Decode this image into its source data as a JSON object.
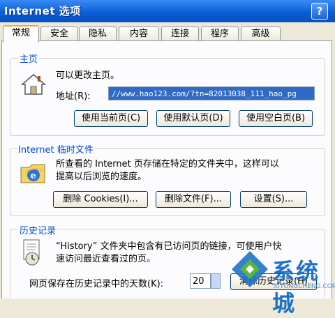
{
  "window": {
    "title": "Internet 选项",
    "help_label": "?"
  },
  "tabs": [
    "常规",
    "安全",
    "隐私",
    "内容",
    "连接",
    "程序",
    "高级"
  ],
  "home_group": {
    "title": "主页",
    "description": "可以更改主页。",
    "address_label": "地址(R):",
    "address_value": "//www.hao123.com/?tn=82013038_111_hao_pg",
    "btn_current": "使用当前页(C)",
    "btn_default": "使用默认页(D)",
    "btn_blank": "使用空白页(B)"
  },
  "temp_group": {
    "title": "Internet 临时文件",
    "description_line1": "所查看的 Internet 页存储在特定的文件夹中，这样可以",
    "description_line2": "提高以后浏览的速度。",
    "btn_delete_cookies": "删除 Cookies(I)...",
    "btn_delete_files": "删除文件(F)...",
    "btn_settings": "设置(S)..."
  },
  "history_group": {
    "title": "历史记录",
    "description_line1": "“History” 文件夹中包含有已访问页的链接，可使用户快",
    "description_line2": "速访问最近查看过的页。",
    "days_label": "网页保存在历史记录中的天数(K):",
    "days_value": "20",
    "btn_clear": "清除历史记录(H)"
  },
  "watermark": {
    "text": "系统城",
    "sub": "XITONGCHENG.COM"
  }
}
